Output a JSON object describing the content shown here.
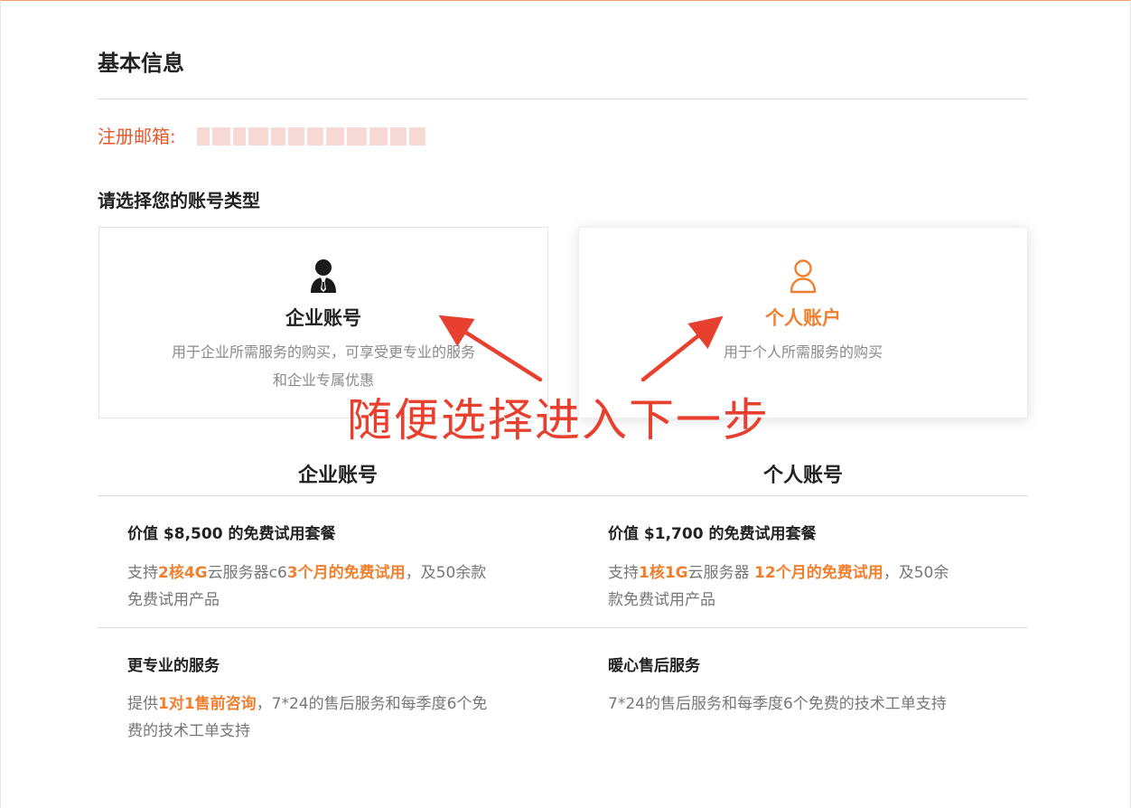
{
  "header": {
    "title": "基本信息"
  },
  "email": {
    "label": "注册邮箱:"
  },
  "account_select": {
    "heading": "请选择您的账号类型"
  },
  "cards": {
    "enterprise": {
      "icon": "business-person-icon",
      "title": "企业账号",
      "desc_line1": "用于企业所需服务的购买，可享受更专业的服务",
      "desc_line2": "和企业专属优惠"
    },
    "personal": {
      "icon": "user-outline-icon",
      "title": "个人账户",
      "desc": "用于个人所需服务的购买"
    }
  },
  "annotation": {
    "text": "随便选择进入下一步"
  },
  "comparison": {
    "enterprise_head": "企业账号",
    "personal_head": "个人账号",
    "enterprise_trial": {
      "title": "价值 $8,500 的免费试用套餐",
      "p1": "支持",
      "h1": "2核4G",
      "p2": "云服务器c6",
      "h2": "3个月的免费试用",
      "p3": "，及50余款",
      "p4": "免费试用产品"
    },
    "personal_trial": {
      "title": "价值 $1,700 的免费试用套餐",
      "p1": "支持",
      "h1": "1核1G",
      "p2": "云服务器 ",
      "h2": "12个月的免费试用",
      "p3": "，及50余",
      "p4": "款免费试用产品"
    },
    "enterprise_service": {
      "title": "更专业的服务",
      "p1": "提供",
      "h1": "1对1售前咨询",
      "p2": "，7*24的售后服务和每季度6个免",
      "p3": "费的技术工单支持"
    },
    "personal_service": {
      "title": "暖心售后服务",
      "desc": "7*24的售后服务和每季度6个免费的技术工单支持"
    }
  },
  "colors": {
    "accent": "#f0802f",
    "email_label": "#e8572c",
    "annotation": "#e8402f"
  }
}
